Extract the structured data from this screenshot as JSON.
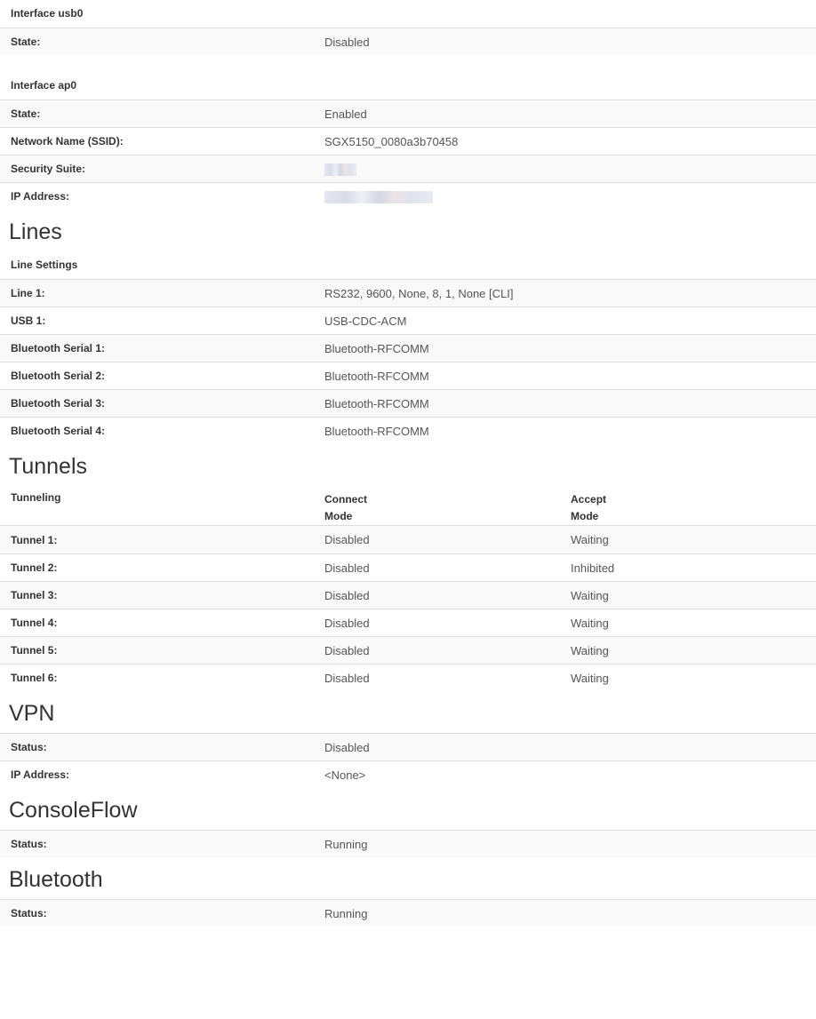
{
  "interface_usb0": {
    "title": "Interface usb0",
    "rows": [
      {
        "label": "State:",
        "value": "Disabled"
      }
    ]
  },
  "interface_ap0": {
    "title": "Interface ap0",
    "rows": [
      {
        "label": "State:",
        "value": "Enabled"
      },
      {
        "label": "Network Name (SSID):",
        "value": "SGX5150_0080a3b70458"
      },
      {
        "label": "Security Suite:",
        "value": ""
      },
      {
        "label": "IP Address:",
        "value": ""
      }
    ]
  },
  "lines": {
    "heading": "Lines",
    "group_title": "Line Settings",
    "rows": [
      {
        "label": "Line 1:",
        "value": "RS232, 9600, None, 8, 1, None [CLI]"
      },
      {
        "label": "USB 1:",
        "value": "USB-CDC-ACM"
      },
      {
        "label": "Bluetooth Serial 1:",
        "value": "Bluetooth-RFCOMM"
      },
      {
        "label": "Bluetooth Serial 2:",
        "value": "Bluetooth-RFCOMM"
      },
      {
        "label": "Bluetooth Serial 3:",
        "value": "Bluetooth-RFCOMM"
      },
      {
        "label": "Bluetooth Serial 4:",
        "value": "Bluetooth-RFCOMM"
      }
    ]
  },
  "tunnels": {
    "heading": "Tunnels",
    "columns": [
      "Tunneling",
      "Connect",
      "Mode",
      "Accept",
      "Mode"
    ],
    "rows": [
      {
        "label": "Tunnel 1:",
        "connect": "Disabled",
        "accept": "Waiting"
      },
      {
        "label": "Tunnel 2:",
        "connect": "Disabled",
        "accept": "Inhibited"
      },
      {
        "label": "Tunnel 3:",
        "connect": "Disabled",
        "accept": "Waiting"
      },
      {
        "label": "Tunnel 4:",
        "connect": "Disabled",
        "accept": "Waiting"
      },
      {
        "label": "Tunnel 5:",
        "connect": "Disabled",
        "accept": "Waiting"
      },
      {
        "label": "Tunnel 6:",
        "connect": "Disabled",
        "accept": "Waiting"
      }
    ]
  },
  "vpn": {
    "heading": "VPN",
    "rows": [
      {
        "label": "Status:",
        "value": "Disabled"
      },
      {
        "label": "IP Address:",
        "value": "<None>"
      }
    ]
  },
  "consoleflow": {
    "heading": "ConsoleFlow",
    "rows": [
      {
        "label": "Status:",
        "value": "Running"
      }
    ]
  },
  "bluetooth": {
    "heading": "Bluetooth",
    "rows": [
      {
        "label": "Status:",
        "value": "Running"
      }
    ]
  },
  "colors": {
    "stripe": "#f9f9f9",
    "border": "#dddddd",
    "text": "#333333",
    "value_text": "#555555"
  }
}
